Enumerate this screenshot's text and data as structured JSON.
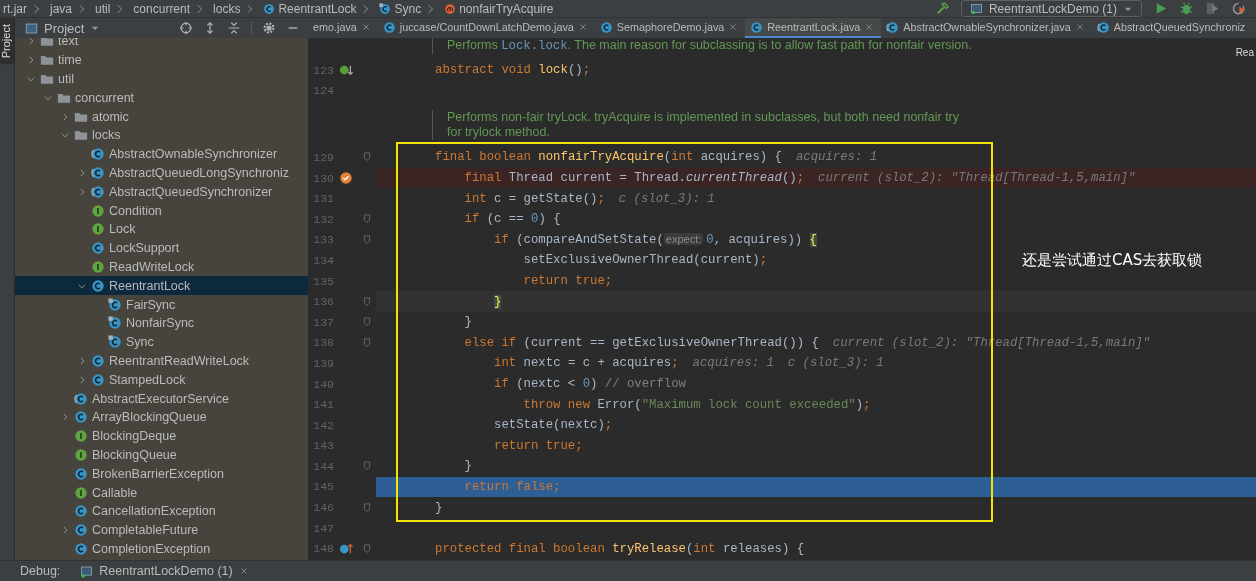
{
  "breadcrumb": [
    {
      "label": "rt.jar"
    },
    {
      "label": "java"
    },
    {
      "label": "util"
    },
    {
      "label": "concurrent"
    },
    {
      "label": "locks"
    },
    {
      "label": "ReentrantLock",
      "kind": "class"
    },
    {
      "label": "Sync",
      "kind": "inner-class"
    },
    {
      "label": "nonfairTryAcquire",
      "kind": "method"
    }
  ],
  "run_config": {
    "label": "ReentrantLockDemo (1)"
  },
  "side_strip": {
    "label": "Project"
  },
  "project": {
    "title": "Project",
    "tree": [
      {
        "label": "text",
        "kind": "folder",
        "expanded": false,
        "selected": false
      },
      {
        "label": "time",
        "kind": "folder",
        "expanded": false,
        "selected": false
      },
      {
        "label": "util",
        "kind": "folder",
        "expanded": true,
        "selected": false,
        "children": [
          {
            "label": "concurrent",
            "kind": "folder",
            "expanded": true,
            "selected": false,
            "children": [
              {
                "label": "atomic",
                "kind": "folder",
                "expanded": false,
                "selected": false
              },
              {
                "label": "locks",
                "kind": "folder",
                "expanded": true,
                "selected": false,
                "children": [
                  {
                    "label": "AbstractOwnableSynchronizer",
                    "kind": "abstract-class",
                    "selected": false
                  },
                  {
                    "label": "AbstractQueuedLongSynchroniz",
                    "kind": "abstract-class",
                    "expanded": false,
                    "selected": false
                  },
                  {
                    "label": "AbstractQueuedSynchronizer",
                    "kind": "abstract-class",
                    "expanded": false,
                    "selected": false
                  },
                  {
                    "label": "Condition",
                    "kind": "interface",
                    "selected": false
                  },
                  {
                    "label": "Lock",
                    "kind": "interface",
                    "selected": false
                  },
                  {
                    "label": "LockSupport",
                    "kind": "class",
                    "selected": false
                  },
                  {
                    "label": "ReadWriteLock",
                    "kind": "interface",
                    "selected": false
                  },
                  {
                    "label": "ReentrantLock",
                    "kind": "class",
                    "expanded": true,
                    "selected": true,
                    "children": [
                      {
                        "label": "FairSync",
                        "kind": "inner-class",
                        "selected": false
                      },
                      {
                        "label": "NonfairSync",
                        "kind": "inner-class",
                        "selected": false
                      },
                      {
                        "label": "Sync",
                        "kind": "inner-class",
                        "selected": false
                      }
                    ]
                  },
                  {
                    "label": "ReentrantReadWriteLock",
                    "kind": "class",
                    "expanded": false,
                    "selected": false
                  },
                  {
                    "label": "StampedLock",
                    "kind": "class",
                    "expanded": false,
                    "selected": false
                  }
                ]
              },
              {
                "label": "AbstractExecutorService",
                "kind": "abstract-class",
                "selected": false
              },
              {
                "label": "ArrayBlockingQueue",
                "kind": "class",
                "expanded": false,
                "selected": false
              },
              {
                "label": "BlockingDeque",
                "kind": "interface",
                "selected": false
              },
              {
                "label": "BlockingQueue",
                "kind": "interface",
                "selected": false
              },
              {
                "label": "BrokenBarrierException",
                "kind": "class",
                "selected": false
              },
              {
                "label": "Callable",
                "kind": "interface",
                "selected": false
              },
              {
                "label": "CancellationException",
                "kind": "class",
                "selected": false
              },
              {
                "label": "CompletableFuture",
                "kind": "class",
                "expanded": false,
                "selected": false
              },
              {
                "label": "CompletionException",
                "kind": "class",
                "selected": false
              }
            ]
          }
        ]
      }
    ]
  },
  "tabs": [
    {
      "label": "emo.java",
      "selected": false,
      "closable": true
    },
    {
      "label": "juccase/CountDownLatchDemo.java",
      "kind": "class",
      "selected": false,
      "closable": true
    },
    {
      "label": "SemaphoreDemo.java",
      "kind": "class",
      "selected": false,
      "closable": true
    },
    {
      "label": "ReentrantLock.java",
      "kind": "class",
      "selected": true,
      "closable": true
    },
    {
      "label": "AbstractOwnableSynchronizer.java",
      "kind": "abstract-class",
      "selected": false,
      "closable": true
    },
    {
      "label": "AbstractQueuedSynchroniz",
      "kind": "abstract-class",
      "selected": false,
      "closable": false
    }
  ],
  "reader_mode_label": "Rea",
  "code": {
    "lines": [
      {
        "kind": "doc",
        "lines": [
          [
            {
              "kind": "text",
              "text": "Performs "
            },
            {
              "kind": "code",
              "text": "Lock.lock"
            },
            {
              "kind": "text",
              "text": ". The main reason for subclassing is to allow fast path for nonfair version."
            }
          ]
        ]
      },
      {
        "kind": "implemented",
        "number": "123",
        "tokens": [
          {
            "kind": "keyword",
            "text": "        abstract void "
          },
          {
            "kind": "function",
            "text": "lock"
          },
          {
            "kind": "plain",
            "text": "()"
          },
          {
            "kind": "keyword",
            "text": ";"
          }
        ]
      },
      {
        "kind": "code",
        "number": "124"
      },
      {
        "kind": "doc",
        "lines": [
          [
            {
              "kind": "text",
              "text": "Performs non-fair tryLock. tryAcquire is implemented in subclasses, but both need nonfair try"
            }
          ],
          [
            {
              "kind": "text",
              "text": "for trylock method."
            }
          ]
        ]
      },
      {
        "kind": "code",
        "number": "129",
        "fold": true,
        "tokens": [
          {
            "kind": "keyword",
            "text": "        final boolean "
          },
          {
            "kind": "function",
            "text": "nonfairTryAcquire"
          },
          {
            "kind": "plain",
            "text": "("
          },
          {
            "kind": "keyword",
            "text": "int "
          },
          {
            "kind": "plain",
            "text": "acquires) {"
          }
        ],
        "hints": [
          "acquires: 1"
        ]
      },
      {
        "kind": "breakpoint",
        "number": "130",
        "tokens": [
          {
            "kind": "keyword",
            "text": "            final "
          },
          {
            "kind": "plain",
            "text": "Thread current = Thread."
          },
          {
            "kind": "italic",
            "text": "currentThread"
          },
          {
            "kind": "plain",
            "text": "()"
          },
          {
            "kind": "keyword",
            "text": ";"
          }
        ],
        "hints": [
          "current (slot_2): \"Thread[Thread-1,5,main]\""
        ]
      },
      {
        "kind": "code",
        "number": "131",
        "tokens": [
          {
            "kind": "keyword",
            "text": "            int "
          },
          {
            "kind": "plain",
            "text": "c = getState()"
          },
          {
            "kind": "keyword",
            "text": ";"
          }
        ],
        "hints": [
          "c (slot_3): 1"
        ]
      },
      {
        "kind": "code",
        "number": "132",
        "fold": true,
        "tokens": [
          {
            "kind": "keyword",
            "text": "            if "
          },
          {
            "kind": "plain",
            "text": "(c == "
          },
          {
            "kind": "number",
            "text": "0"
          },
          {
            "kind": "plain",
            "text": ") {"
          }
        ]
      },
      {
        "kind": "code",
        "number": "133",
        "fold": true,
        "tokens": [
          {
            "kind": "keyword",
            "text": "                if "
          },
          {
            "kind": "plain",
            "text": "(compareAndSetState("
          },
          {
            "kind": "param-hint",
            "text": "expect:"
          },
          {
            "kind": "number",
            "text": "0"
          },
          {
            "kind": "plain",
            "text": ", acquires)) "
          },
          {
            "kind": "brace-match",
            "text": "{"
          }
        ]
      },
      {
        "kind": "code",
        "number": "134",
        "tokens": [
          {
            "kind": "plain",
            "text": "                    setExclusiveOwnerThread(current)"
          },
          {
            "kind": "keyword",
            "text": ";"
          }
        ]
      },
      {
        "kind": "code",
        "number": "135",
        "tokens": [
          {
            "kind": "keyword",
            "text": "                    return true;"
          }
        ]
      },
      {
        "kind": "caret",
        "number": "136",
        "fold": true,
        "tokens": [
          {
            "kind": "brace-match",
            "text": "                }"
          }
        ]
      },
      {
        "kind": "code",
        "number": "137",
        "fold": true,
        "tokens": [
          {
            "kind": "plain",
            "text": "            }"
          }
        ]
      },
      {
        "kind": "code",
        "number": "138",
        "fold": true,
        "tokens": [
          {
            "kind": "keyword",
            "text": "            else if "
          },
          {
            "kind": "plain",
            "text": "(current == getExclusiveOwnerThread()) {"
          }
        ],
        "hints": [
          "current (slot_2): \"Thread[Thread-1,5,main]\""
        ]
      },
      {
        "kind": "code",
        "number": "139",
        "tokens": [
          {
            "kind": "keyword",
            "text": "                int "
          },
          {
            "kind": "plain",
            "text": "nextc = c + acquires"
          },
          {
            "kind": "keyword",
            "text": ";"
          }
        ],
        "hints": [
          "acquires: 1",
          "c (slot_3): 1"
        ]
      },
      {
        "kind": "code",
        "number": "140",
        "tokens": [
          {
            "kind": "keyword",
            "text": "                if "
          },
          {
            "kind": "plain",
            "text": "(nextc < "
          },
          {
            "kind": "number",
            "text": "0"
          },
          {
            "kind": "plain",
            "text": ") "
          },
          {
            "kind": "comment",
            "text": "// overflow"
          }
        ]
      },
      {
        "kind": "code",
        "number": "141",
        "tokens": [
          {
            "kind": "keyword",
            "text": "                    throw new "
          },
          {
            "kind": "plain",
            "text": "Error("
          },
          {
            "kind": "string",
            "text": "\"Maximum lock count exceeded\""
          },
          {
            "kind": "plain",
            "text": ")"
          },
          {
            "kind": "keyword",
            "text": ";"
          }
        ]
      },
      {
        "kind": "code",
        "number": "142",
        "tokens": [
          {
            "kind": "plain",
            "text": "                setState(nextc)"
          },
          {
            "kind": "keyword",
            "text": ";"
          }
        ]
      },
      {
        "kind": "code",
        "number": "143",
        "tokens": [
          {
            "kind": "keyword",
            "text": "                return true;"
          }
        ]
      },
      {
        "kind": "code",
        "number": "144",
        "fold": true,
        "tokens": [
          {
            "kind": "plain",
            "text": "            }"
          }
        ]
      },
      {
        "kind": "execution",
        "number": "145",
        "tokens": [
          {
            "kind": "keyword",
            "text": "            return false;"
          }
        ]
      },
      {
        "kind": "code",
        "number": "146",
        "fold": true,
        "tokens": [
          {
            "kind": "plain",
            "text": "        }"
          }
        ]
      },
      {
        "kind": "code",
        "number": "147"
      },
      {
        "kind": "overriding",
        "number": "148",
        "fold": true,
        "tokens": [
          {
            "kind": "keyword",
            "text": "        protected final boolean "
          },
          {
            "kind": "function",
            "text": "tryRelease"
          },
          {
            "kind": "plain",
            "text": "("
          },
          {
            "kind": "keyword",
            "text": "int "
          },
          {
            "kind": "plain",
            "text": "releases) {"
          }
        ]
      }
    ]
  },
  "annotation": {
    "note": "还是尝试通过CAS去获取锁"
  },
  "debug_bar": {
    "label": "Debug:",
    "session": "ReentrantLockDemo (1)"
  }
}
